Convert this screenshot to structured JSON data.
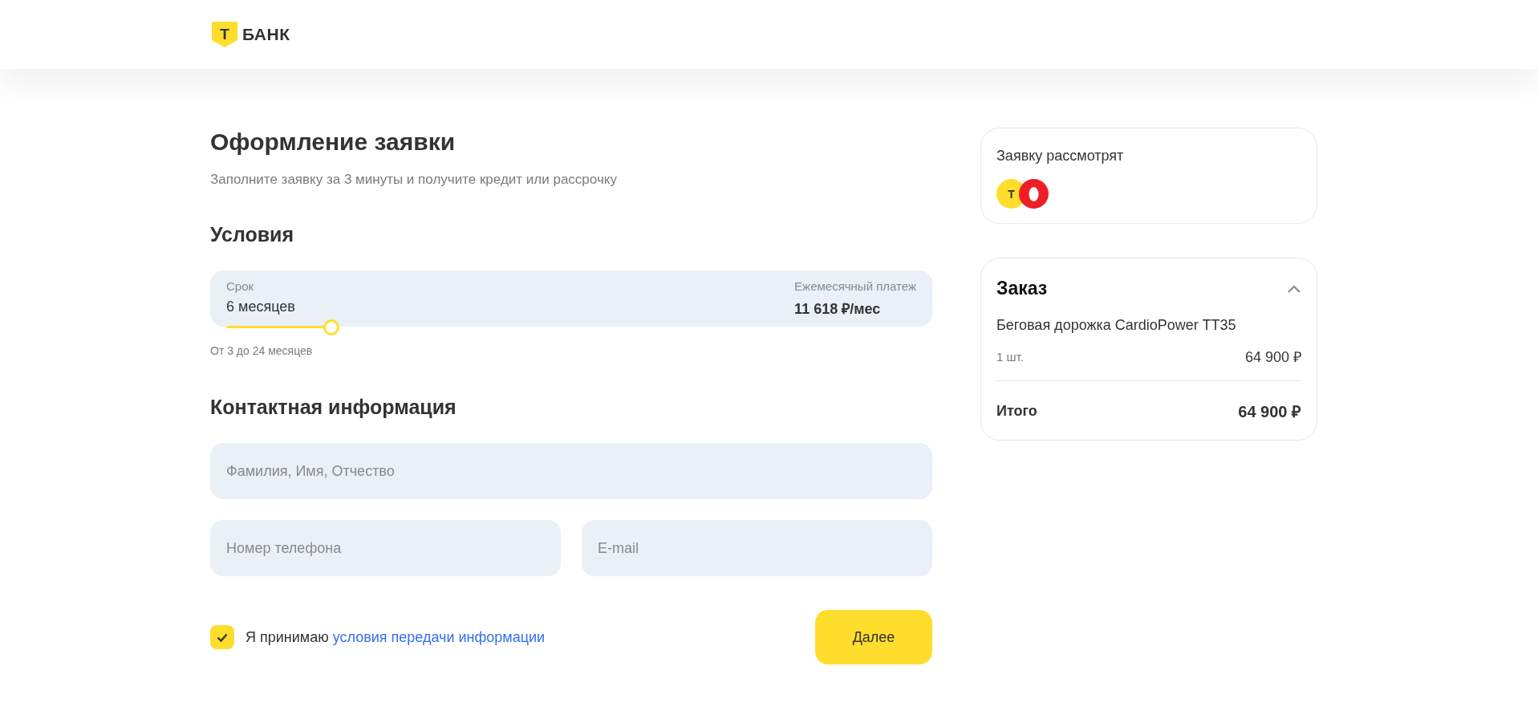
{
  "header": {
    "logo": {
      "mark": "Т",
      "name": "БАНК"
    }
  },
  "form": {
    "title": "Оформление заявки",
    "subtitle": "Заполните заявку за 3 минуты и получите кредит или рассрочку",
    "conditions": {
      "heading": "Условия",
      "term_label": "Срок",
      "term_value": "6 месяцев",
      "payment_label": "Ежемесячный платеж",
      "payment_value": "11 618 ₽/мес",
      "level": 0.143,
      "hint": "От 3 до 24 месяцев"
    },
    "contacts": {
      "heading": "Контактная информация",
      "fields": [
        {
          "placeholder": "Фамилия, Имя, Отчество",
          "kind": "full"
        },
        {
          "placeholder": "Номер телефона",
          "kind": "half"
        },
        {
          "placeholder": "E-mail",
          "kind": "half"
        }
      ]
    },
    "consent": {
      "checked": true,
      "text": "Я принимаю",
      "link": "условия передачи информации"
    },
    "submit": "Далее"
  },
  "review": {
    "title": "Заявку рассмотрят",
    "banks": [
      {
        "kind": "tbank",
        "mark": "Т"
      },
      {
        "kind": "red"
      }
    ]
  },
  "order": {
    "title": "Заказ",
    "expanded": true,
    "item": "Беговая дорожка CardioPower TT35",
    "qty": "1 шт.",
    "price": "64 900 ₽",
    "total_label": "Итого",
    "total": "64 900 ₽"
  }
}
